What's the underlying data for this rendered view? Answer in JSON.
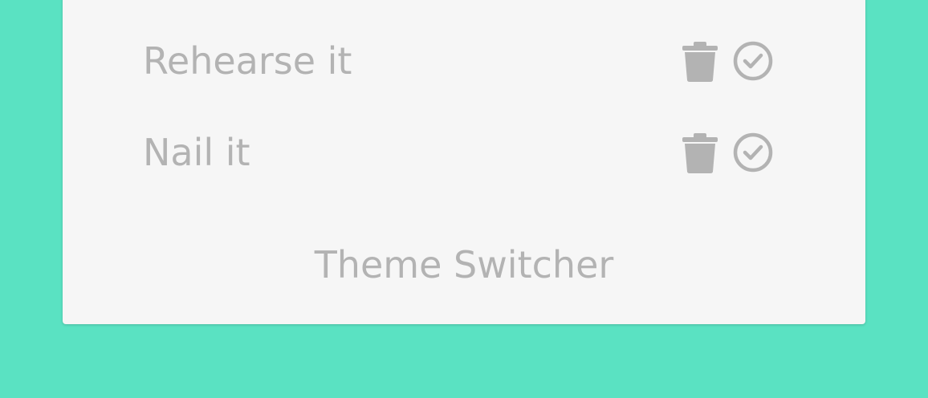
{
  "colors": {
    "background": "#5ae2c2",
    "card": "#f6f6f6",
    "text": "#b3b3b3",
    "icon": "#b3b3b3"
  },
  "todos": [
    {
      "text": "Rehearse it",
      "icons": [
        "trash-icon",
        "check-circle-icon"
      ]
    },
    {
      "text": "Nail it",
      "icons": [
        "trash-icon",
        "check-circle-icon"
      ]
    }
  ],
  "footer": {
    "theme_switcher_label": "Theme Switcher"
  }
}
